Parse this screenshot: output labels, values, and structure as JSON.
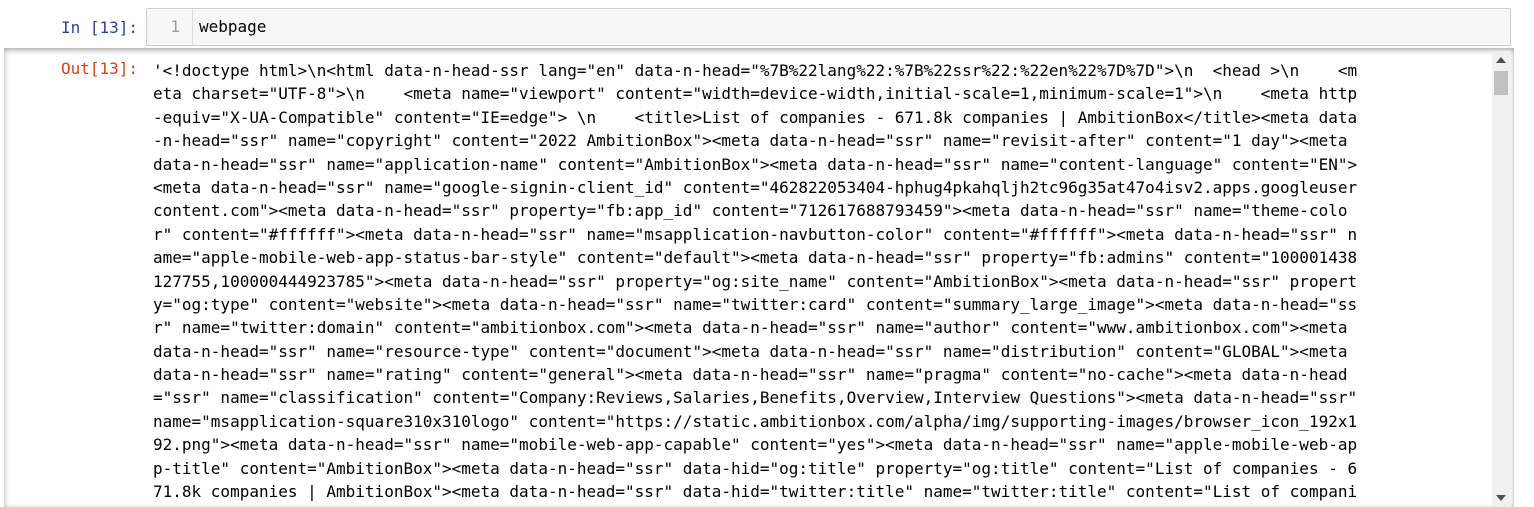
{
  "input_cell": {
    "prompt": "In [13]:",
    "line_number": "1",
    "code": "webpage"
  },
  "output_cell": {
    "prompt": "Out[13]:",
    "lines": [
      "'<!doctype html>\\n<html data-n-head-ssr lang=\"en\" data-n-head=\"%7B%22lang%22:%7B%22ssr%22:%22en%22%7D%7D\">\\n  <head >\\n    <m",
      "eta charset=\"UTF-8\">\\n    <meta name=\"viewport\" content=\"width=device-width,initial-scale=1,minimum-scale=1\">\\n    <meta http",
      "-equiv=\"X-UA-Compatible\" content=\"IE=edge\"> \\n    <title>List of companies - 671.8k companies | AmbitionBox</title><meta data",
      "-n-head=\"ssr\" name=\"copyright\" content=\"2022 AmbitionBox\"><meta data-n-head=\"ssr\" name=\"revisit-after\" content=\"1 day\"><meta",
      "data-n-head=\"ssr\" name=\"application-name\" content=\"AmbitionBox\"><meta data-n-head=\"ssr\" name=\"content-language\" content=\"EN\">",
      "<meta data-n-head=\"ssr\" name=\"google-signin-client_id\" content=\"462822053404-hphug4pkahqljh2tc96g35at47o4isv2.apps.googleuser",
      "content.com\"><meta data-n-head=\"ssr\" property=\"fb:app_id\" content=\"712617688793459\"><meta data-n-head=\"ssr\" name=\"theme-colo",
      "r\" content=\"#ffffff\"><meta data-n-head=\"ssr\" name=\"msapplication-navbutton-color\" content=\"#ffffff\"><meta data-n-head=\"ssr\" n",
      "ame=\"apple-mobile-web-app-status-bar-style\" content=\"default\"><meta data-n-head=\"ssr\" property=\"fb:admins\" content=\"100001438",
      "127755,100000444923785\"><meta data-n-head=\"ssr\" property=\"og:site_name\" content=\"AmbitionBox\"><meta data-n-head=\"ssr\" propert",
      "y=\"og:type\" content=\"website\"><meta data-n-head=\"ssr\" name=\"twitter:card\" content=\"summary_large_image\"><meta data-n-head=\"ss",
      "r\" name=\"twitter:domain\" content=\"ambitionbox.com\"><meta data-n-head=\"ssr\" name=\"author\" content=\"www.ambitionbox.com\"><meta",
      "data-n-head=\"ssr\" name=\"resource-type\" content=\"document\"><meta data-n-head=\"ssr\" name=\"distribution\" content=\"GLOBAL\"><meta",
      "data-n-head=\"ssr\" name=\"rating\" content=\"general\"><meta data-n-head=\"ssr\" name=\"pragma\" content=\"no-cache\"><meta data-n-head",
      "=\"ssr\" name=\"classification\" content=\"Company:Reviews,Salaries,Benefits,Overview,Interview Questions\"><meta data-n-head=\"ssr\"",
      "name=\"msapplication-square310x310logo\" content=\"https://static.ambitionbox.com/alpha/img/supporting-images/browser_icon_192x1",
      "92.png\"><meta data-n-head=\"ssr\" name=\"mobile-web-app-capable\" content=\"yes\"><meta data-n-head=\"ssr\" name=\"apple-mobile-web-ap",
      "p-title\" content=\"AmbitionBox\"><meta data-n-head=\"ssr\" data-hid=\"og:title\" property=\"og:title\" content=\"List of companies - 6",
      "71.8k companies | AmbitionBox\"><meta data-n-head=\"ssr\" data-hid=\"twitter:title\" name=\"twitter:title\" content=\"List of compani"
    ]
  },
  "icons": {
    "scroll_up": "arrow-up-icon",
    "scroll_down": "arrow-down-icon"
  },
  "colors": {
    "in_prompt": "#303f9f",
    "out_prompt": "#d84315",
    "input_background": "#f7f7f7"
  }
}
